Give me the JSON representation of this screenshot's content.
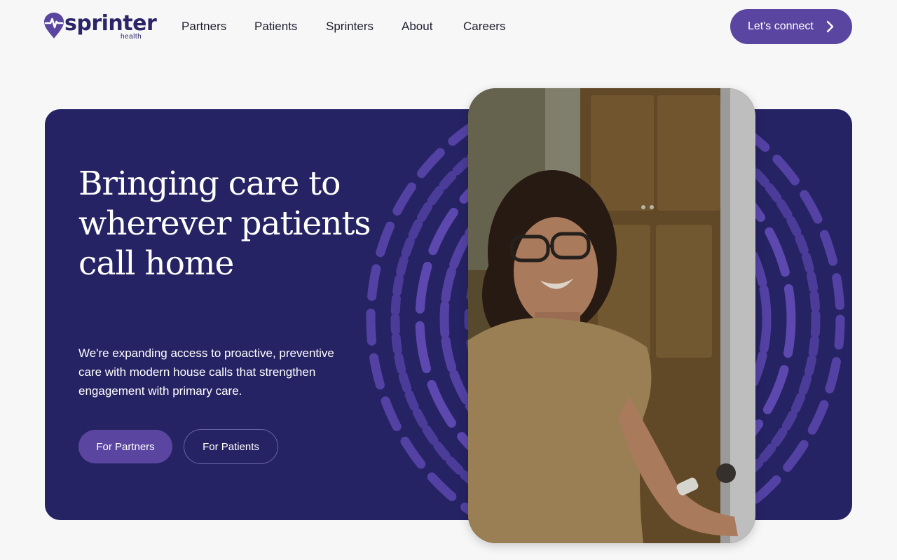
{
  "header": {
    "logo": {
      "name": "sprinter",
      "sub": "health"
    },
    "nav": [
      {
        "label": "Partners"
      },
      {
        "label": "Patients"
      },
      {
        "label": "Sprinters"
      },
      {
        "label": "About"
      },
      {
        "label": "Careers"
      }
    ],
    "cta": {
      "label": "Let's connect",
      "icon": "chevron-right-icon"
    }
  },
  "hero": {
    "headline": "Bringing care to wherever patients call home",
    "subtext": "We're expanding access to proactive, preventive care with modern house calls that strengthen engagement with primary care.",
    "buttons": {
      "partners": "For Partners",
      "patients": "For Patients"
    },
    "image": {
      "subject": "smiling-woman-at-door"
    }
  },
  "colors": {
    "brand_purple": "#5a46a0",
    "hero_navy": "#262364",
    "ring_purple": "#6a52c4",
    "page_bg": "#f7f7f8",
    "logo_text": "#2b2466"
  }
}
